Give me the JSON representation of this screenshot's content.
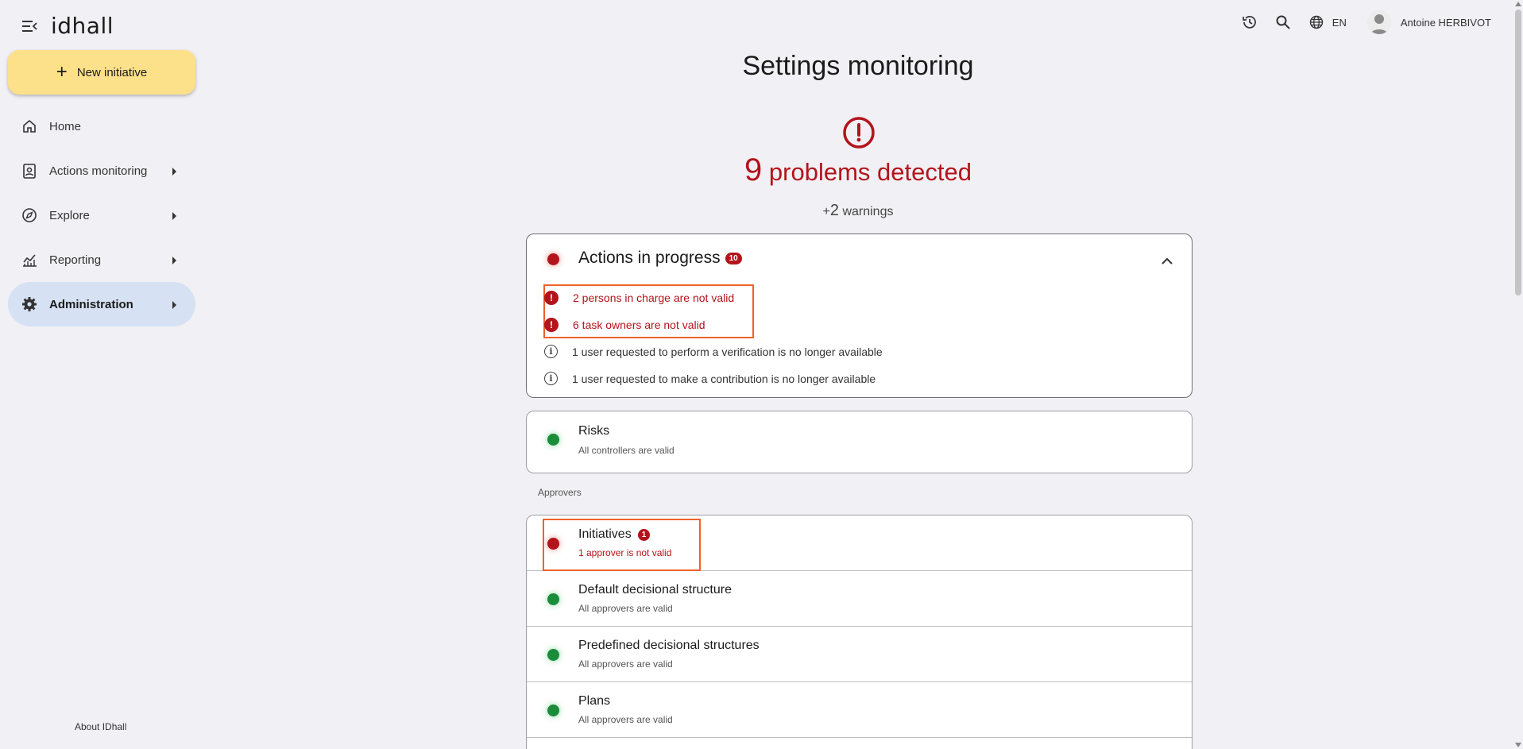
{
  "app": {
    "logo_text": "idhall",
    "new_initiative_label": "New initiative",
    "about_label": "About IDhall"
  },
  "nav": {
    "items": [
      {
        "label": "Home",
        "icon": "home-icon"
      },
      {
        "label": "Actions monitoring",
        "icon": "clipboard-user-icon"
      },
      {
        "label": "Explore",
        "icon": "compass-icon"
      },
      {
        "label": "Reporting",
        "icon": "chart-icon"
      },
      {
        "label": "Administration",
        "icon": "gear-icon"
      }
    ]
  },
  "header": {
    "language": "EN",
    "user_name": "Antoine HERBIVOT"
  },
  "page": {
    "title": "Settings monitoring",
    "problems_count": "9",
    "problems_label": "problems detected",
    "warnings_prefix": "+",
    "warnings_count": "2",
    "warnings_label": "warnings"
  },
  "actions_card": {
    "title": "Actions in progress",
    "badge": "10",
    "issues": [
      {
        "type": "error",
        "text": "2 persons in charge are not valid"
      },
      {
        "type": "error",
        "text": "6 task owners are not valid"
      },
      {
        "type": "info",
        "text": "1 user requested to perform a verification is no longer available"
      },
      {
        "type": "info",
        "text": "1 user requested to make a contribution is no longer available"
      }
    ]
  },
  "risks_card": {
    "title": "Risks",
    "subtitle": "All controllers are valid"
  },
  "approvers": {
    "section_label": "Approvers",
    "rows": [
      {
        "title": "Initiatives",
        "badge": "1",
        "subtitle": "1 approver is not valid",
        "status": "error"
      },
      {
        "title": "Default decisional structure",
        "subtitle": "All approvers are valid",
        "status": "ok"
      },
      {
        "title": "Predefined decisional structures",
        "subtitle": "All approvers are valid",
        "status": "ok"
      },
      {
        "title": "Plans",
        "subtitle": "All approvers are valid",
        "status": "ok"
      }
    ]
  },
  "colors": {
    "error": "#b3141b",
    "ok": "#1a8c3a",
    "highlight": "#f0612a",
    "accent": "#fde18a",
    "nav_active": "#d6e2f3"
  }
}
